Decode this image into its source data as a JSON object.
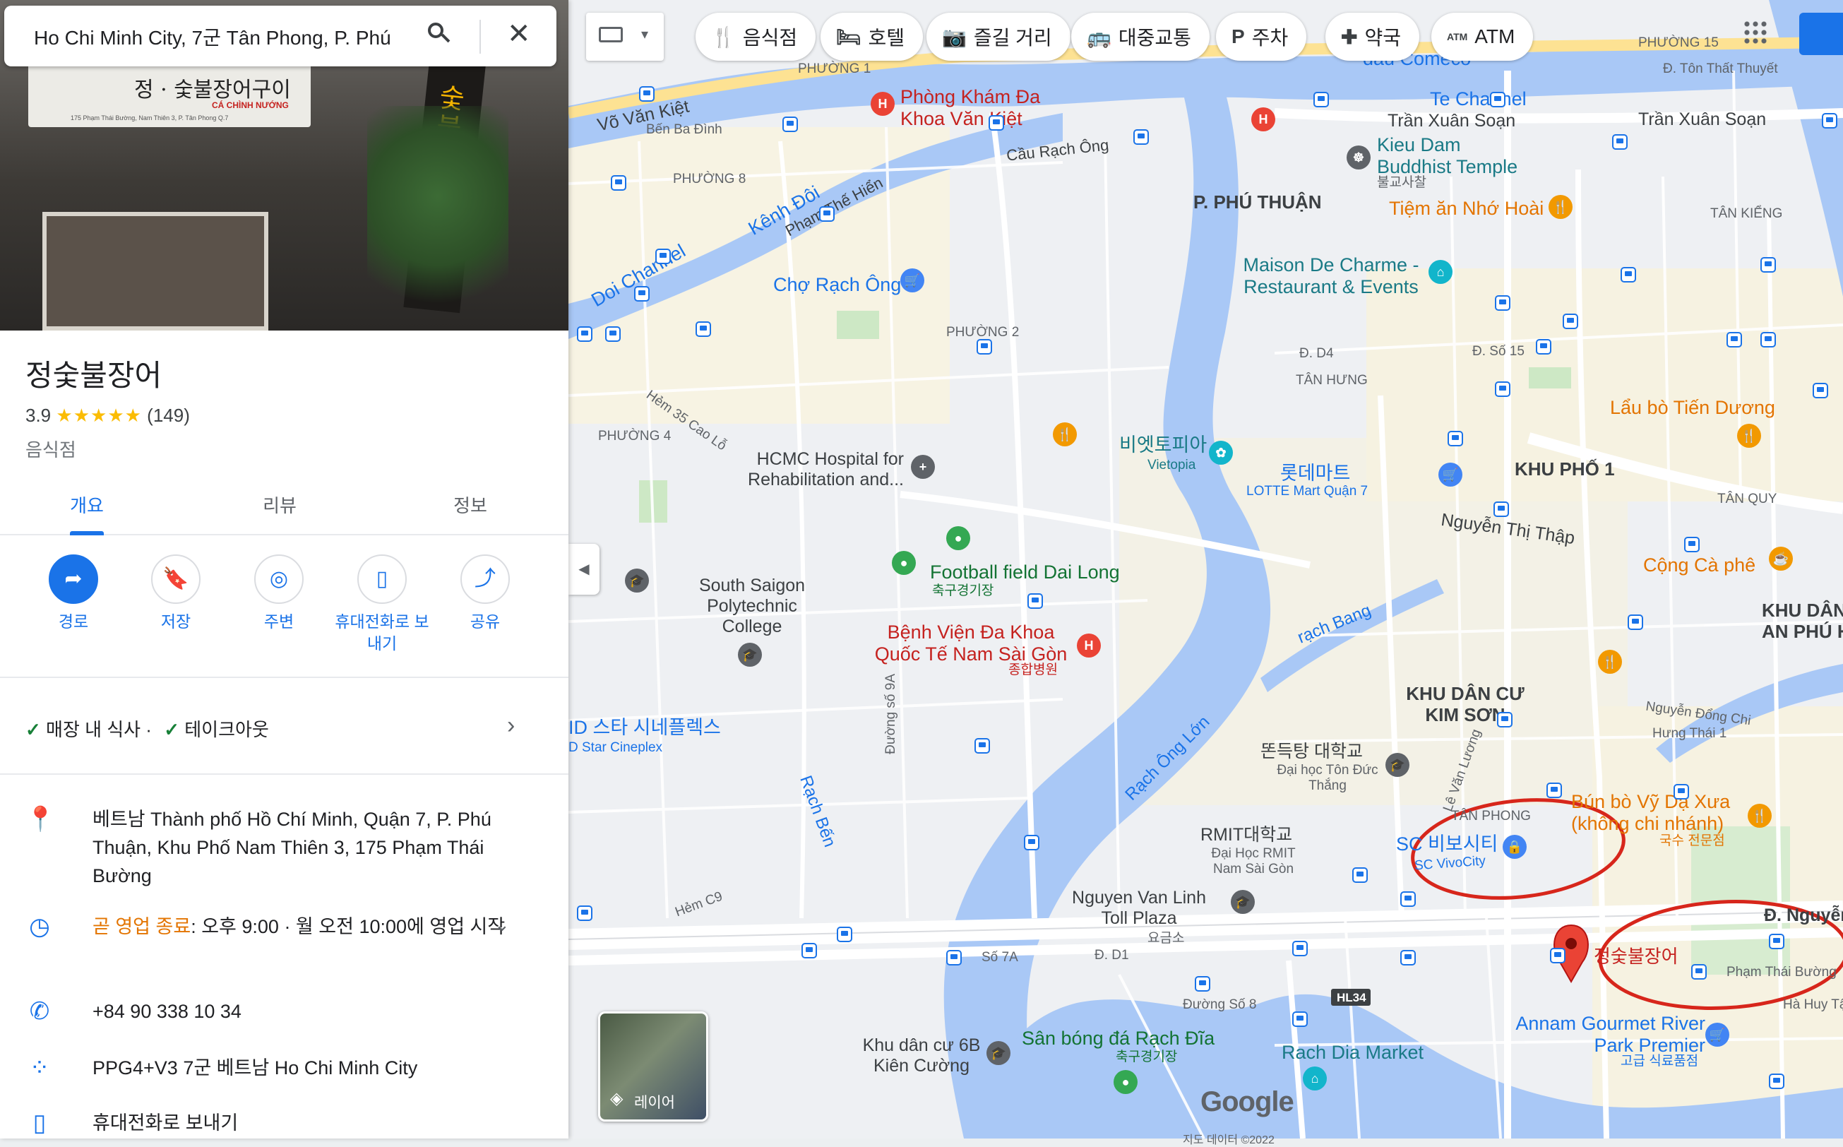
{
  "search": {
    "query": "Ho Chi Minh City, 7군 Tân Phong, P. Phú"
  },
  "categories": [
    {
      "label": "음식점",
      "icon": "fork-knife-icon"
    },
    {
      "label": "호텔",
      "icon": "bed-icon"
    },
    {
      "label": "즐길 거리",
      "icon": "camera-icon"
    },
    {
      "label": "대중교통",
      "icon": "bus-icon"
    },
    {
      "label": "주차",
      "icon": "parking-icon"
    },
    {
      "label": "약국",
      "icon": "pharmacy-icon"
    },
    {
      "label": "ATM",
      "icon": "atm-icon"
    }
  ],
  "photo": {
    "sign_main": "정 · 숯불장어구이",
    "sign_sub": "CÁ CHÌNH NƯỚNG",
    "sign_addr": "175 Phạm Thái Bường, Nam Thiên 3, P. Tân Phong Q.7",
    "vertical_sign": "숯불장어"
  },
  "place": {
    "name": "정숯불장어",
    "rating": "3.9",
    "stars": "★★★★★",
    "reviews": "(149)",
    "category": "음식점"
  },
  "tabs": [
    "개요",
    "리뷰",
    "정보"
  ],
  "actions": [
    {
      "label": "경로",
      "icon": "directions-icon"
    },
    {
      "label": "저장",
      "icon": "bookmark-icon"
    },
    {
      "label": "주변",
      "icon": "nearby-icon"
    },
    {
      "label": "휴대전화로 보내기",
      "icon": "send-to-phone-icon"
    },
    {
      "label": "공유",
      "icon": "share-icon"
    }
  ],
  "services": {
    "dine_in": "매장 내 식사 ·",
    "takeout": "테이크아웃"
  },
  "info": {
    "address": "베트남 Thành phố Hồ Chí Minh, Quận 7, P. Phú Thuận, Khu Phố Nam Thiên 3, 175 Phạm Thái Bường",
    "hours_status": "곧 영업 종료",
    "hours_detail": ": 오후 9:00 · 월 오전 10:00에 영업 시작",
    "phone": "+84 90 338 10 34",
    "plus_code": "PPG4+V3 7군 베트남 Ho Chi Minh City",
    "send_to_phone": "휴대전화로 보내기"
  },
  "map": {
    "layer_label": "레이어",
    "google": "Google",
    "footer": "지도 데이터 ©2022",
    "labels": {
      "te_channel": "Te Channel",
      "vo_van_kiet": "Võ Văn Kiệt",
      "ben_ba_dinh": "Bến Ba Đình",
      "phong_kham": "Phòng Khám Đa Khoa Văn Kiệt",
      "cau_rach_ong": "Cầu Rạch Ông",
      "tran_xuan_soan_1": "Trần Xuân Soạn",
      "tran_xuan_soan_2": "Trần Xuân Soạn",
      "kieu_dam": "Kieu Dam Buddhist Temple",
      "kieu_dam_ko": "불교사찰",
      "phuong_8": "PHƯỜNG 8",
      "kenh_doi": "Kênh Đôi",
      "pham_the_hien": "Phạm Thế Hiển",
      "doi_channel": "Doi Channel",
      "p_phu_thuan": "P. PHÚ THUẬN",
      "tiem_an": "Tiệm ăn Nhớ Hoài",
      "tan_kieng": "TÂN KIỂNG",
      "cho_rach_ong": "Chợ Rạch Ông",
      "maison": "Maison De Charme - Restaurant & Events",
      "phuong_2": "PHƯỜNG 2",
      "tan_hung": "TÂN HƯNG",
      "phuong_4": "PHƯỜNG 4",
      "vietopia": "비엣토피아",
      "vietopia_en": "Vietopia",
      "lotte": "롯데마트",
      "lotte_en": "LOTTE Mart Quận 7",
      "khu_pho_1": "KHU PHỐ 1",
      "lau_bo": "Lẩu bò Tiến Dương",
      "hcmc_hospital": "HCMC Hospital for Rehabilitation and...",
      "nguyen_thi_thap": "Nguyễn Thị Thập",
      "tan_quy": "TÂN QUY",
      "football": "Football field Dai Long",
      "football_ko": "축구경기장",
      "cong_ca_phe": "Cộng Cà phê",
      "south_saigon": "South Saigon Polytechnic College",
      "benh_vien": "Bệnh Viện Đa Khoa Quốc Tế Nam Sài Gòn",
      "benh_vien_ko": "종합병원",
      "rach_bang": "rạch Bang",
      "khu_dan_cu_kim_son": "KHU DÂN CƯ KIM SƠN",
      "khu_dan_an_phu": "KHU DÂN AN PHÚ H",
      "cinema": "ID 스타 시네플렉스",
      "cinema_en": "D Star Cineplex",
      "rach_ong_lon": "Rạch Ông Lớn",
      "ton_duc_thang": "똔득탕 대학교",
      "ton_duc_thang_vi": "Đại học Tôn Đức Thắng",
      "tan_phong": "TÂN PHONG",
      "rmit": "RMIT대학교",
      "rmit_vi": "Đại Học RMIT Nam Sài Gòn",
      "sc_vivo": "SC 비보시티",
      "sc_vivo_en": "SC VivoCity",
      "bun_bo": "Bún bò Vỹ Dạ Xưa (không chi nhánh)",
      "bun_bo_ko": "국수 전문점",
      "rach_ben": "Rạch Bến",
      "nguyen_van_linh": "Nguyen Van Linh Toll Plaza",
      "toll_ko": "요금소",
      "d_nguyen": "Đ. Nguyễn",
      "pin_label": "정숯불장어",
      "pham_thai_buong": "Phạm Thái Bường",
      "ha_huy_tap": "Hà Huy Tậ",
      "annam": "Annam Gourmet River Park Premier",
      "annam_ko": "고급 식료품점",
      "khu_dan_cu_6b": "Khu dân cư 6B Kiên Cường",
      "san_bong": "Sân bóng đá Rạch Đĩa",
      "san_bong_ko": "축구경기장",
      "rach_dia": "Rach Dia Market",
      "hl34": "HL34",
      "phuong_1": "PHƯỜNG 1",
      "phuong_15": "PHƯỜNG 15",
      "ton_that_thuyet": "Đ. Tôn Thất Thuyết",
      "dau_comeco": "dầu Comeco",
      "d_d1": "Đ. D1",
      "so_7a": "Số 7A",
      "duong_so_8": "Đường Số 8",
      "duong_so_9a": "Đường số 9A",
      "hem_c9": "Hẻm C9",
      "hem_35": "Hẻm 35 Cao Lỗ",
      "le_van_luong": "Lê Văn Lương",
      "d_so_15": "Đ. Số 15",
      "d_d4": "Đ. D4",
      "nguyen_dong_chi": "Nguyễn Đổng Chi",
      "hung_thai": "Hưng Thái 1"
    }
  }
}
